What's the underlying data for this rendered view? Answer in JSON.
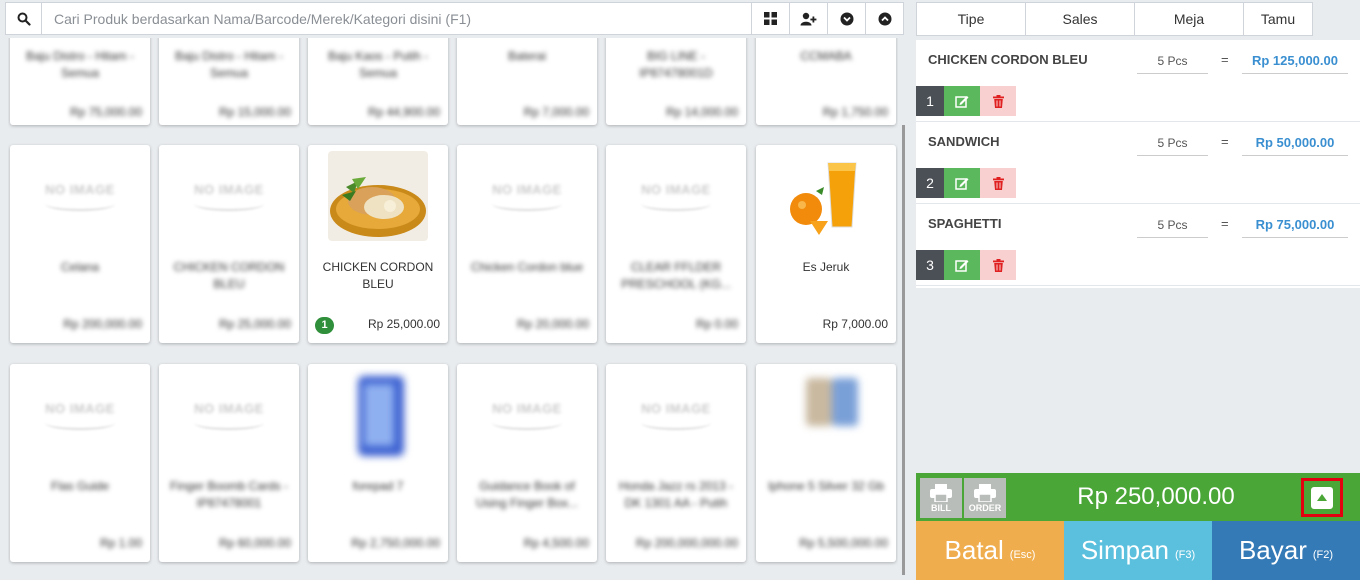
{
  "search": {
    "placeholder": "Cari Produk berdasarkan Nama/Barcode/Merek/Kategori disini (F1)"
  },
  "toolbar_icons": [
    "search-icon",
    "grid-icon",
    "add-user-icon",
    "chevron-down-icon",
    "chevron-up-icon"
  ],
  "products_row1": [
    {
      "name": "Baju Distro - Hitam - Semua",
      "price": "Rp 75,000.00",
      "price_color": "red"
    },
    {
      "name": "Baju Distro - Hitam - Semua",
      "price": "Rp 15,000.00",
      "price_color": "red"
    },
    {
      "name": "Baju Kaos - Putih - Semua",
      "price": "Rp 44,900.00",
      "price_color": "red"
    },
    {
      "name": "Baterai",
      "price": "Rp 7,000.00",
      "price_color": "gray"
    },
    {
      "name": "BIG LINE - IP87478001D",
      "price": "Rp 14,000.00",
      "price_color": "gray"
    },
    {
      "name": "CCMABA",
      "price": "Rp 1,750.00",
      "price_color": "gray"
    }
  ],
  "products_row2": [
    {
      "name": "Celana",
      "price": "Rp 200,000.00",
      "image": "no-image"
    },
    {
      "name": "CHICKEN CORDON BLEU",
      "price": "Rp 25,000.00",
      "image": "no-image"
    },
    {
      "name": "CHICKEN CORDON BLEU",
      "price": "Rp 25,000.00",
      "image": "chicken-cordon-bleu-photo",
      "badge": "1"
    },
    {
      "name": "Chicken Cordon blue",
      "price": "Rp 20,000.00",
      "image": "no-image"
    },
    {
      "name": "CLEAR FFLDER PRESCHOOL (KG...",
      "price": "Rp 0.00",
      "image": "no-image"
    },
    {
      "name": "Es Jeruk",
      "price": "Rp 7,000.00",
      "image": "orange-juice-photo"
    }
  ],
  "products_row3": [
    {
      "name": "Flas Guide",
      "price": "Rp 1.00",
      "image": "no-image"
    },
    {
      "name": "Finger Boomb Cards - IP87478001",
      "price": "Rp 60,000.00",
      "image": "no-image"
    },
    {
      "name": "forepad 7",
      "price": "Rp 2,750,000.00",
      "image": "blue-phone-photo"
    },
    {
      "name": "Guidance Book of Using Finger Box...",
      "price": "Rp 4,500.00",
      "image": "no-image"
    },
    {
      "name": "Honda Jazz rs 2013 - DK 1301 AA - Putih",
      "price": "Rp 200,000,000.00",
      "image": "no-image"
    },
    {
      "name": "Iphone 5 Silver 32 Gb",
      "price": "Rp 5,500,000.00",
      "image": "silver-phone-photo"
    }
  ],
  "no_image_text": "NO IMAGE",
  "tabs": [
    "Tipe",
    "Sales",
    "Meja",
    "Tamu"
  ],
  "cart": [
    {
      "num": "1",
      "name": "CHICKEN CORDON BLEU",
      "qty": "5 Pcs",
      "eq": "=",
      "total": "Rp 125,000.00"
    },
    {
      "num": "2",
      "name": "SANDWICH",
      "qty": "5 Pcs",
      "eq": "=",
      "total": "Rp 50,000.00"
    },
    {
      "num": "3",
      "name": "SPAGHETTI",
      "qty": "5 Pcs",
      "eq": "=",
      "total": "Rp 75,000.00"
    }
  ],
  "print_buttons": {
    "bill": "BILL",
    "order": "ORDER"
  },
  "grand_total": "Rp 250,000.00",
  "actions": [
    {
      "label": "Batal",
      "key": "(Esc)",
      "color": "#f0ad4e"
    },
    {
      "label": "Simpan",
      "key": "(F3)",
      "color": "#5bc0de"
    },
    {
      "label": "Bayar",
      "key": "(F2)",
      "color": "#337ab7"
    }
  ],
  "colors": {
    "total_bar": "#4aa637",
    "highlight_border": "#e3000f",
    "edit": "#5cb85c",
    "delete_bg": "#f8d0d0",
    "price_link": "#3a8fd1"
  }
}
